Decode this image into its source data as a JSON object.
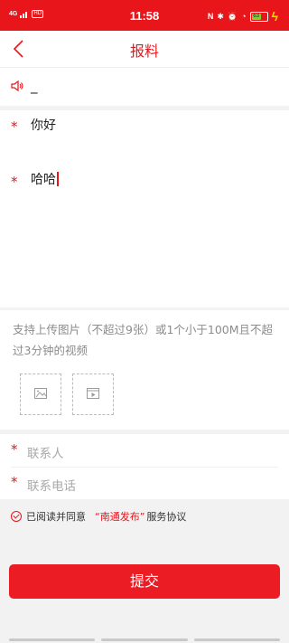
{
  "status_bar": {
    "time": "11:58",
    "network": "4G",
    "hd": "HD",
    "battery_level": "63",
    "icons": [
      "nfc-icon",
      "bluetooth-icon",
      "alarm-icon",
      "dnd-icon",
      "battery-icon",
      "charging-icon"
    ]
  },
  "nav": {
    "title": "报料",
    "back_icon": "chevron-left-icon"
  },
  "notice": {
    "text": "_"
  },
  "form": {
    "title_value": "你好",
    "content_value": "哈哈",
    "required_mark": "*",
    "upload_hint": "支持上传图片（不超过9张）或1个小于100M且不超过3分钟的视频",
    "contact_person_placeholder": "联系人",
    "contact_phone_placeholder": "联系电话"
  },
  "agreement": {
    "prefix": "已阅读并同意",
    "link": "“南通发布”",
    "suffix": "服务协议"
  },
  "submit_label": "提交",
  "colors": {
    "accent": "#e8151b",
    "background": "#f2f2f2"
  }
}
